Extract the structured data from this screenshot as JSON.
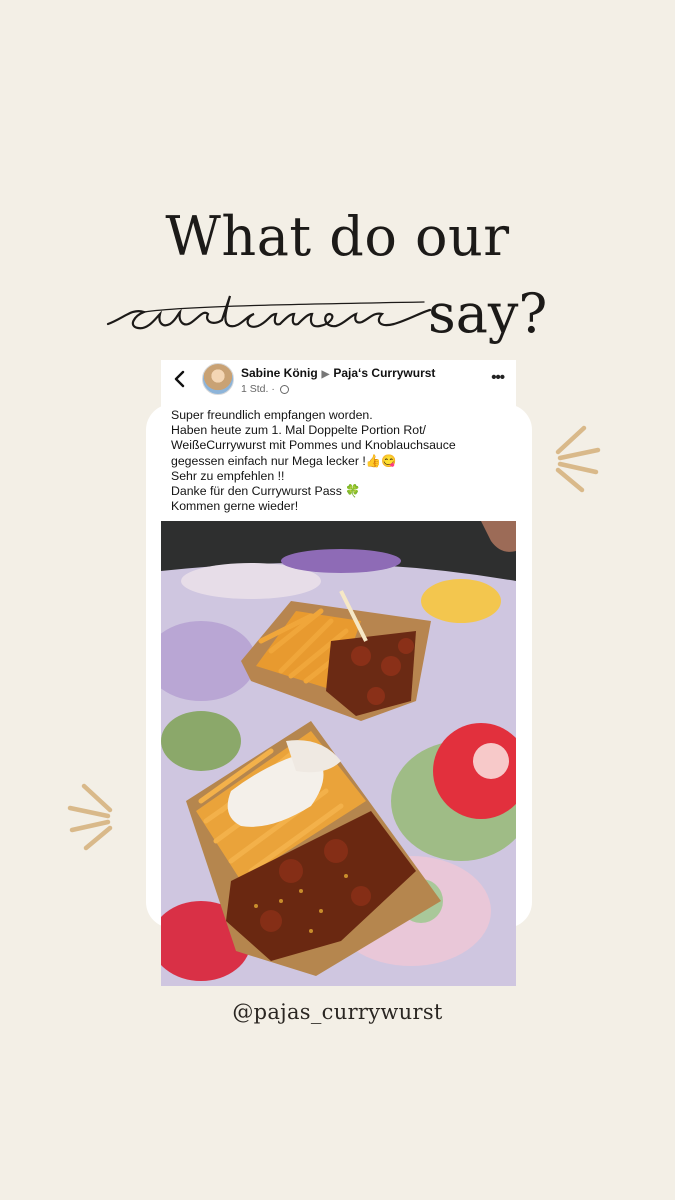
{
  "headline": {
    "line1": "What do our",
    "line2_script": "customers",
    "line2_end": "say?"
  },
  "post": {
    "author": "Sabine König",
    "page_name": "Paja‘s Currywurst",
    "time": "1 Std.",
    "separator": "·",
    "lines": [
      "Super freundlich empfangen worden.",
      "Haben heute zum 1. Mal Doppelte Portion Rot/",
      "WeißeCurrywurst mit Pommes und Knoblauchsauce",
      "gegessen einfach nur Mega lecker !👍😋",
      "Sehr zu empfehlen !!",
      "Danke für den Currywurst Pass 🍀",
      "Kommen gerne wieder!"
    ]
  },
  "icons": {
    "back": "chevron-left-icon",
    "more": "more-horizontal-icon",
    "privacy": "globe-icon"
  },
  "handle": "@pajas_currywurst",
  "colors": {
    "background": "#f3efe6",
    "accent_burst": "#d9b98a",
    "text_dark": "#1c1a18"
  }
}
